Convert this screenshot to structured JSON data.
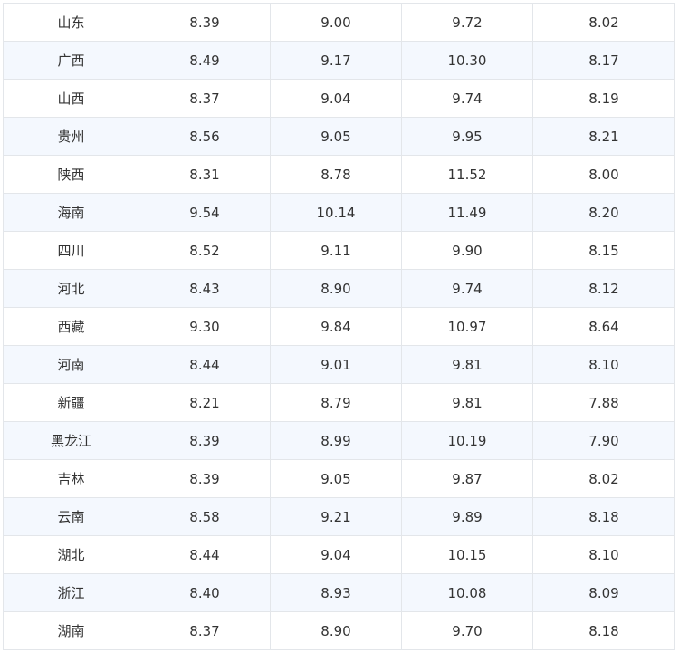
{
  "table": {
    "rows": [
      [
        "山东",
        "8.39",
        "9.00",
        "9.72",
        "8.02"
      ],
      [
        "广西",
        "8.49",
        "9.17",
        "10.30",
        "8.17"
      ],
      [
        "山西",
        "8.37",
        "9.04",
        "9.74",
        "8.19"
      ],
      [
        "贵州",
        "8.56",
        "9.05",
        "9.95",
        "8.21"
      ],
      [
        "陕西",
        "8.31",
        "8.78",
        "11.52",
        "8.00"
      ],
      [
        "海南",
        "9.54",
        "10.14",
        "11.49",
        "8.20"
      ],
      [
        "四川",
        "8.52",
        "9.11",
        "9.90",
        "8.15"
      ],
      [
        "河北",
        "8.43",
        "8.90",
        "9.74",
        "8.12"
      ],
      [
        "西藏",
        "9.30",
        "9.84",
        "10.97",
        "8.64"
      ],
      [
        "河南",
        "8.44",
        "9.01",
        "9.81",
        "8.10"
      ],
      [
        "新疆",
        "8.21",
        "8.79",
        "9.81",
        "7.88"
      ],
      [
        "黑龙江",
        "8.39",
        "8.99",
        "10.19",
        "7.90"
      ],
      [
        "吉林",
        "8.39",
        "9.05",
        "9.87",
        "8.02"
      ],
      [
        "云南",
        "8.58",
        "9.21",
        "9.89",
        "8.18"
      ],
      [
        "湖北",
        "8.44",
        "9.04",
        "10.15",
        "8.10"
      ],
      [
        "浙江",
        "8.40",
        "8.93",
        "10.08",
        "8.09"
      ],
      [
        "湖南",
        "8.37",
        "8.90",
        "9.70",
        "8.18"
      ]
    ]
  },
  "colors": {
    "border": "#e3e6ea",
    "stripe": "#f4f8fe",
    "text": "#333333"
  }
}
